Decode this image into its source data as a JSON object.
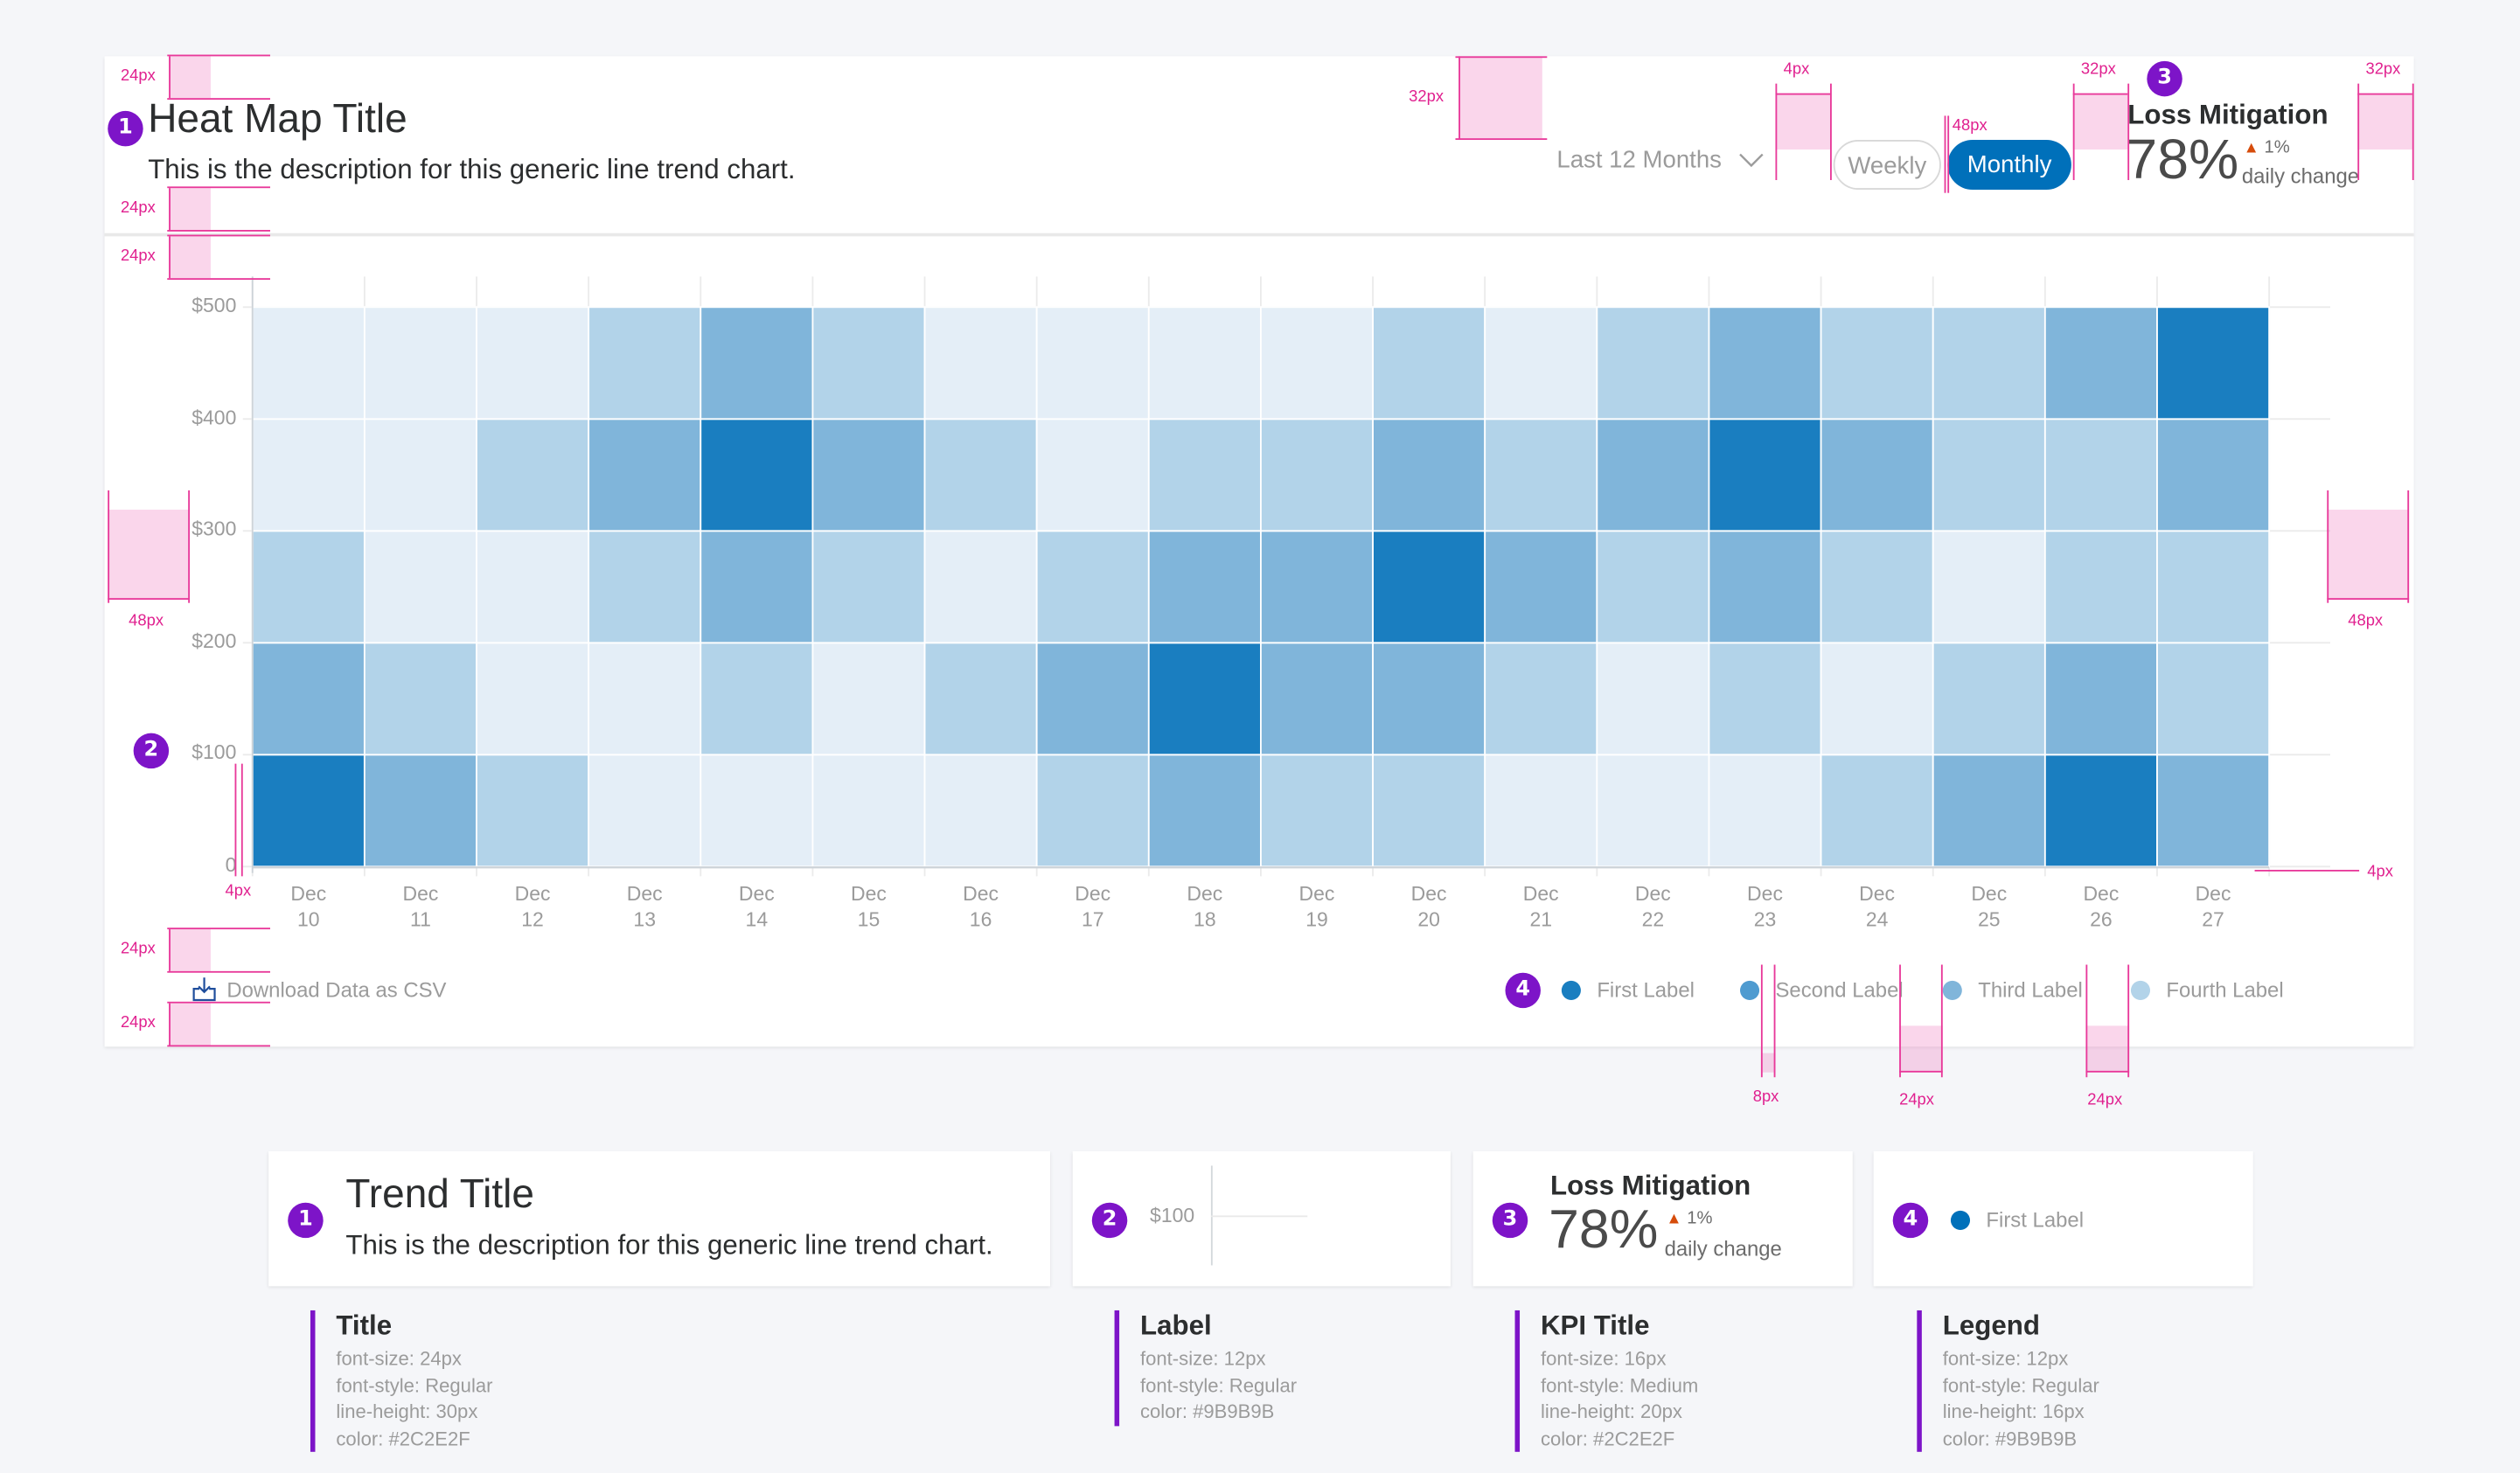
{
  "header": {
    "title": "Heat Map Title",
    "description": "This is the description for this generic line trend chart.",
    "period_select": {
      "value": "Last 12 Months",
      "icon": "chevron-down-icon"
    },
    "toggle": {
      "options": [
        "Weekly",
        "Monthly"
      ],
      "selected": "Monthly"
    },
    "kpi": {
      "title": "Loss Mitigation",
      "value": "78%",
      "change": "1%",
      "change_direction": "up",
      "change_label": "daily change",
      "change_color": "#D64C0B"
    }
  },
  "footer": {
    "download_label": "Download Data as CSV",
    "download_icon": "download-icon"
  },
  "badges": [
    "1",
    "2",
    "3",
    "4"
  ],
  "annotations": {
    "spacing_labels": [
      "24px",
      "24px",
      "24px",
      "48px",
      "32px",
      "4px",
      "32px",
      "32px",
      "48px",
      "48px",
      "4px",
      "4px",
      "24px",
      "24px",
      "8px",
      "24px",
      "24px"
    ]
  },
  "colors": {
    "accent": "#0070BA",
    "badge": "#7D14C8",
    "annotation": "#E0208F",
    "title_text": "#2C2E2F",
    "label_text": "#9B9B9B",
    "scale": [
      "#E4EEF7",
      "#B2D3E9",
      "#80B5DA",
      "#1A7EC0"
    ]
  },
  "chart_data": {
    "type": "heatmap",
    "title": "Heat Map Title",
    "xlabel": "",
    "ylabel": "",
    "x": [
      "Dec 10",
      "Dec 11",
      "Dec 12",
      "Dec 13",
      "Dec 14",
      "Dec 15",
      "Dec 16",
      "Dec 17",
      "Dec 18",
      "Dec 19",
      "Dec 20",
      "Dec 21",
      "Dec 22",
      "Dec 23",
      "Dec 24",
      "Dec 25",
      "Dec 26",
      "Dec 27"
    ],
    "x_ticks": [
      {
        "top": "Dec",
        "bottom": "10"
      },
      {
        "top": "Dec",
        "bottom": "11"
      },
      {
        "top": "Dec",
        "bottom": "12"
      },
      {
        "top": "Dec",
        "bottom": "13"
      },
      {
        "top": "Dec",
        "bottom": "14"
      },
      {
        "top": "Dec",
        "bottom": "15"
      },
      {
        "top": "Dec",
        "bottom": "16"
      },
      {
        "top": "Dec",
        "bottom": "17"
      },
      {
        "top": "Dec",
        "bottom": "18"
      },
      {
        "top": "Dec",
        "bottom": "19"
      },
      {
        "top": "Dec",
        "bottom": "20"
      },
      {
        "top": "Dec",
        "bottom": "21"
      },
      {
        "top": "Dec",
        "bottom": "22"
      },
      {
        "top": "Dec",
        "bottom": "23"
      },
      {
        "top": "Dec",
        "bottom": "24"
      },
      {
        "top": "Dec",
        "bottom": "25"
      },
      {
        "top": "Dec",
        "bottom": "26"
      },
      {
        "top": "Dec",
        "bottom": "27"
      }
    ],
    "y_bins": [
      "0-$100",
      "$100-$200",
      "$200-$300",
      "$300-$400",
      "$400-$500"
    ],
    "y_ticks": [
      "0",
      "$100",
      "$200",
      "$300",
      "$400",
      "$500"
    ],
    "ylim": [
      0,
      500
    ],
    "grid": true,
    "legend": {
      "position": "bottom-right",
      "items": [
        {
          "label": "First Label",
          "color": "#1A7EC0"
        },
        {
          "label": "Second Label",
          "color": "#4F9BD0"
        },
        {
          "label": "Third Label",
          "color": "#80B5DA"
        },
        {
          "label": "Fourth Label",
          "color": "#B2D3E9"
        }
      ]
    },
    "intensity_levels": 4,
    "values_note": "intensity level 0 (lightest) to 3 (darkest); rows ordered bottom (0-$100) to top ($400-$500)",
    "values": [
      [
        3,
        2,
        1,
        0,
        0
      ],
      [
        2,
        1,
        0,
        0,
        0
      ],
      [
        1,
        0,
        0,
        1,
        0
      ],
      [
        0,
        0,
        1,
        2,
        1
      ],
      [
        0,
        1,
        2,
        3,
        2
      ],
      [
        0,
        0,
        1,
        2,
        1
      ],
      [
        0,
        1,
        0,
        1,
        0
      ],
      [
        1,
        2,
        1,
        0,
        0
      ],
      [
        2,
        3,
        2,
        1,
        0
      ],
      [
        1,
        2,
        2,
        1,
        0
      ],
      [
        1,
        2,
        3,
        2,
        1
      ],
      [
        0,
        1,
        2,
        1,
        0
      ],
      [
        0,
        0,
        1,
        2,
        1
      ],
      [
        0,
        1,
        2,
        3,
        2
      ],
      [
        1,
        0,
        1,
        2,
        1
      ],
      [
        2,
        1,
        0,
        1,
        1
      ],
      [
        3,
        2,
        1,
        1,
        2
      ],
      [
        2,
        1,
        1,
        2,
        3
      ]
    ]
  },
  "spec_cards": [
    {
      "title": "Trend Title",
      "description": "This is the description for this generic line trend chart."
    },
    {
      "label_sample": "$100"
    },
    {
      "kpi_title": "Loss Mitigation",
      "kpi_value": "78%",
      "change": "1%",
      "change_label": "daily change"
    },
    {
      "legend_sample": "First Label",
      "legend_color": "#0070BA"
    }
  ],
  "specs": [
    {
      "title": "Title",
      "lines": [
        "font-size: 24px",
        "font-style: Regular",
        "line-height: 30px",
        "color: #2C2E2F"
      ]
    },
    {
      "title": "Label",
      "lines": [
        "font-size: 12px",
        "font-style: Regular",
        "color: #9B9B9B"
      ]
    },
    {
      "title": "KPI Title",
      "lines": [
        "font-size: 16px",
        "font-style: Medium",
        "line-height: 20px",
        "color: #2C2E2F"
      ]
    },
    {
      "title": "Legend",
      "lines": [
        "font-size: 12px",
        "font-style: Regular",
        "line-height: 16px",
        "color: #9B9B9B"
      ]
    }
  ]
}
